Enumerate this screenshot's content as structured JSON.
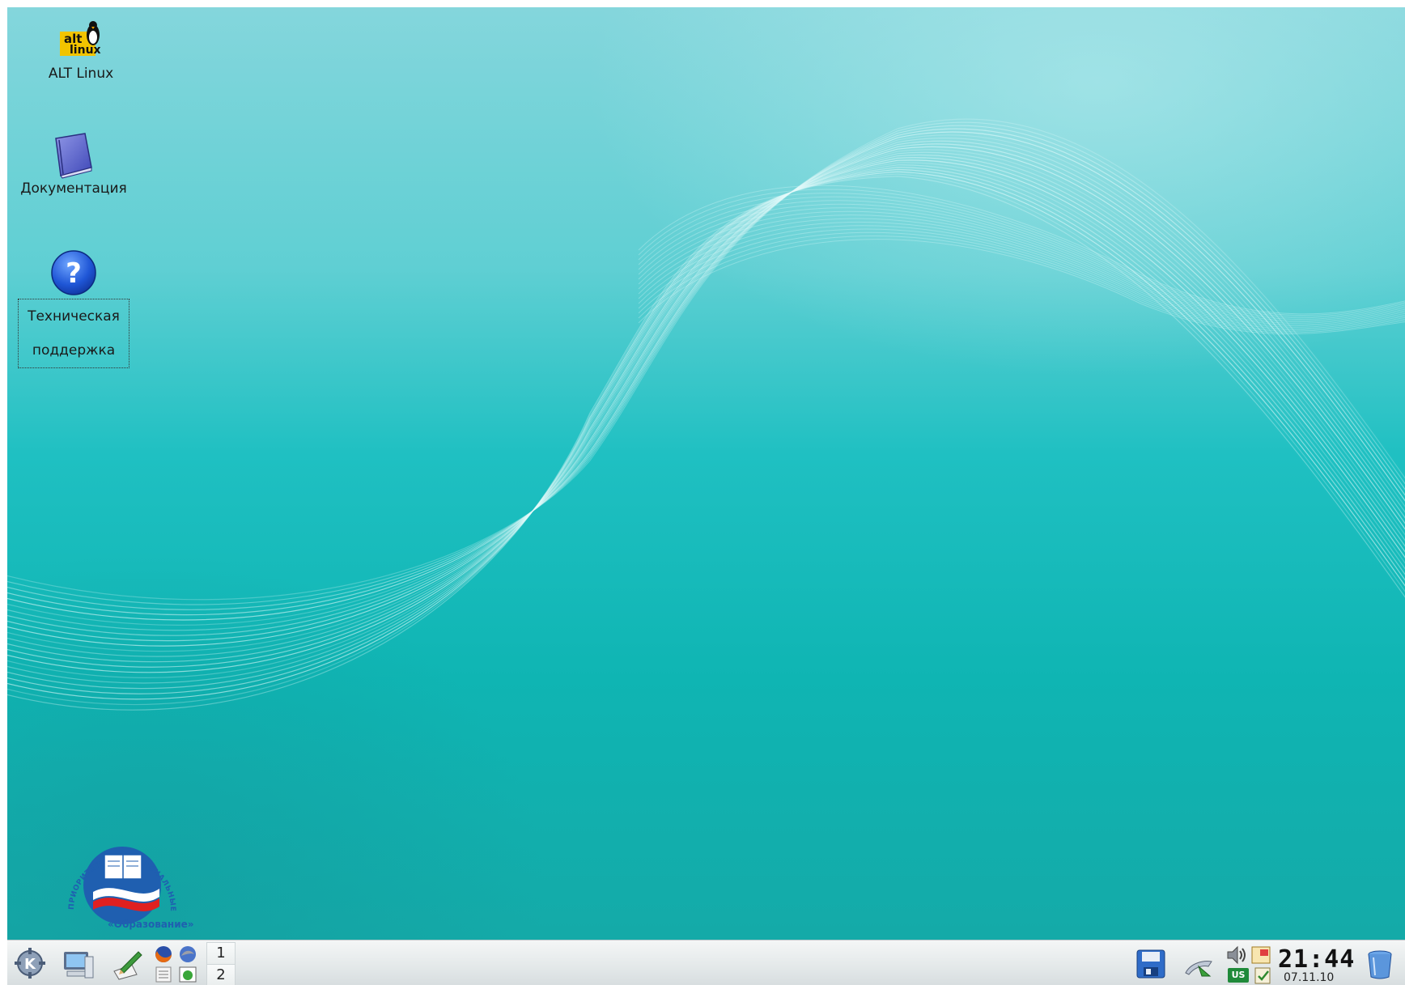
{
  "desktop": {
    "icons": [
      {
        "label": "ALT Linux",
        "icon": "alt-linux-logo-icon",
        "logo_text": [
          "alt",
          "linux"
        ]
      },
      {
        "label": "Документация",
        "icon": "book-icon"
      },
      {
        "label": "Техническая поддержка",
        "icon": "help-question-icon"
      }
    ],
    "logo": {
      "top_arc_text": "ПРИОРИТЕТНЫЕ НАЦИОНАЛЬНЫЕ ПРОЕКТЫ",
      "bottom_text": "«Образование»"
    },
    "colors": {
      "wallpaper": "#1fc0c2",
      "wave": "#e6fbfb"
    }
  },
  "taskbar": {
    "launchers": [
      {
        "name": "kde-menu-icon"
      },
      {
        "name": "computer-icon"
      },
      {
        "name": "edit-pen-icon"
      },
      {
        "name": "firefox-icon"
      },
      {
        "name": "thunderbird-icon"
      },
      {
        "name": "text-editor-icon"
      },
      {
        "name": "photo-icon"
      }
    ],
    "pager": [
      "1",
      "2"
    ],
    "tray": {
      "icons": [
        "save-icon",
        "network-icon",
        "volume-icon",
        "notes-icon",
        "clipboard-icon"
      ],
      "keyboard_layout": "US",
      "clock_time": "21:44",
      "clock_date": "07.11.10",
      "trash_icon": "trash-icon"
    }
  }
}
